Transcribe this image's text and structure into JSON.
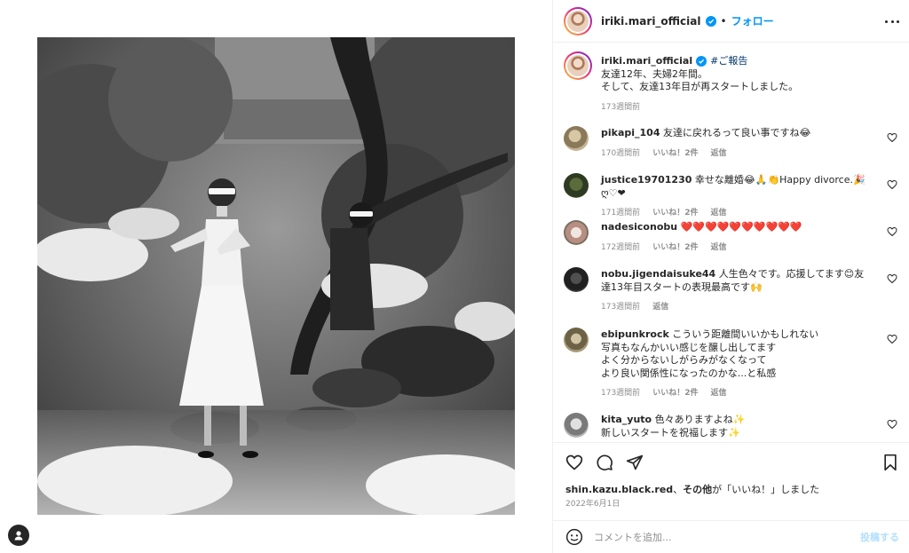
{
  "post": {
    "username": "iriki.mari_official",
    "follow_label": "フォロー",
    "separator": "•",
    "icons": {
      "more": "more-horizontal-icon",
      "verified": "verified-badge-icon",
      "user_tag": "user-tag-icon"
    },
    "photo_alt": "black-and-white photo"
  },
  "caption": {
    "username": "iriki.mari_official",
    "hashtag": "#ご報告",
    "line1": "友達12年、夫婦2年間。",
    "line2": "そして、友達13年目が再スタートしました。",
    "time": "173週間前"
  },
  "comments": [
    {
      "username": "pikapi_104",
      "text": "友達に戻れるって良い事ですね😂",
      "time": "170週間前",
      "likes": "いいね！2件",
      "reply": "返信"
    },
    {
      "username": "justice19701230",
      "text": "幸せな離婚😂🙏👏Happy divorce.🎉ღ♡❤",
      "time": "171週間前",
      "likes": "いいね！2件",
      "reply": "返信"
    },
    {
      "username": "nadesiconobu",
      "text": "❤️❤️❤️❤️❤️❤️❤️❤️❤️❤️",
      "time": "172週間前",
      "likes": "いいね！2件",
      "reply": "返信"
    },
    {
      "username": "nobu.jigendaisuke44",
      "text": "人生色々です。応援してます😊友達13年目スタートの表現最高です🙌",
      "time": "173週間前",
      "likes": "",
      "reply": "返信"
    },
    {
      "username": "ebipunkrock",
      "text": "こういう距離間いいかもしれない",
      "line2": "写真もなんかいい感じを醸し出してます",
      "line3": "よく分からないしがらみがなくなって",
      "line4": "より良い関係性になったのかな...と私感",
      "time": "173週間前",
      "likes": "いいね！2件",
      "reply": "返信"
    },
    {
      "username": "kita_yuto",
      "text": "色々ありますよね✨",
      "line2": "新しいスタートを祝福します✨",
      "time": "",
      "likes": "",
      "reply": ""
    }
  ],
  "actions": {
    "icons": [
      "heart-icon",
      "comment-icon",
      "share-icon",
      "bookmark-icon"
    ],
    "liked_by_user": "shin.kazu.black.red",
    "liked_by_rest_1": "、",
    "liked_by_bold": "その他",
    "liked_by_rest_2": "が「いいね！」しました",
    "date": "2022年6月1日"
  },
  "comment_box": {
    "placeholder": "コメントを追加...",
    "post_label": "投稿する",
    "emoji_icon": "emoji-icon"
  }
}
